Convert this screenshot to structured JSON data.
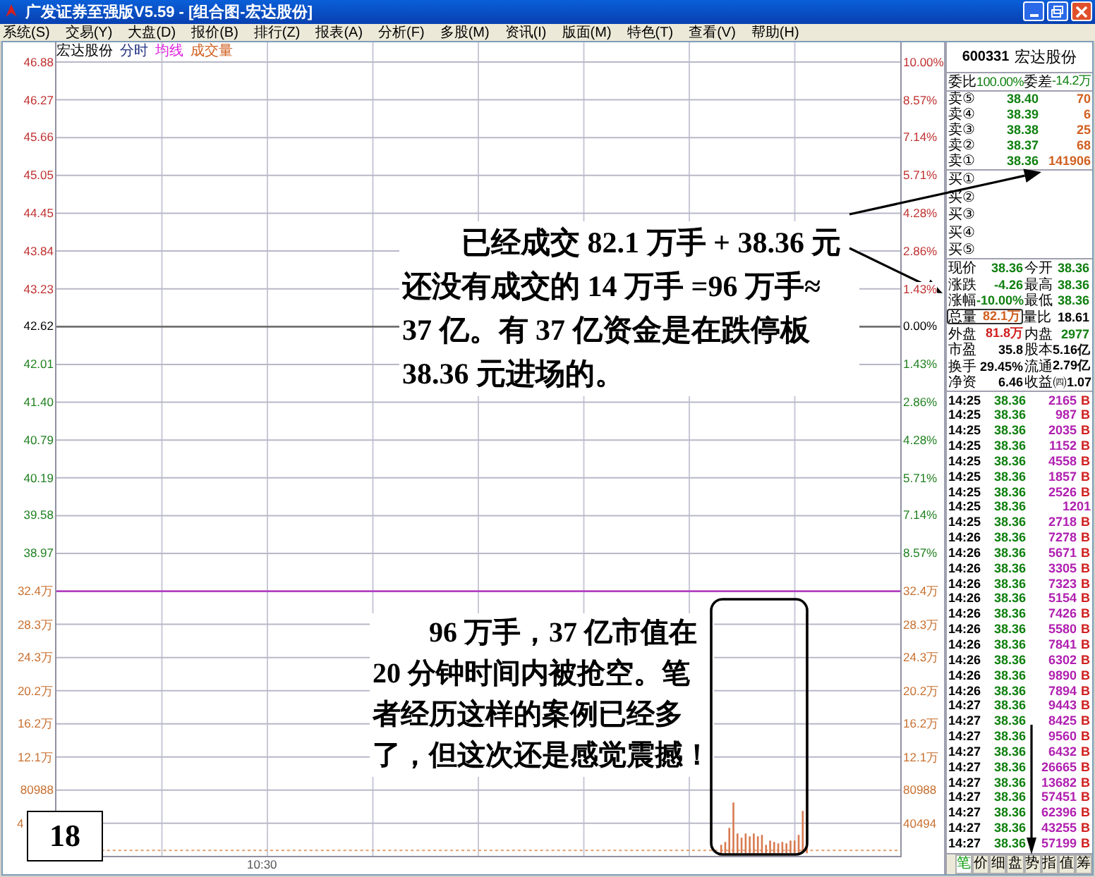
{
  "window": {
    "title": "广发证券至强版V5.59 - [组合图-宏达股份]"
  },
  "menu": [
    "系统(S)",
    "交易(Y)",
    "大盘(D)",
    "报价(B)",
    "排行(Z)",
    "报表(A)",
    "分析(F)",
    "多股(M)",
    "资讯(I)",
    "版面(M)",
    "特色(T)",
    "查看(V)",
    "帮助(H)"
  ],
  "chart": {
    "header": {
      "name": "宏达股份",
      "mode": "分时",
      "ma": "均线",
      "volume": "成交量"
    },
    "left_axis": [
      {
        "label": "46.88",
        "kind": "up"
      },
      {
        "label": "46.27",
        "kind": "up"
      },
      {
        "label": "45.66",
        "kind": "up"
      },
      {
        "label": "45.05",
        "kind": "up"
      },
      {
        "label": "44.45",
        "kind": "up"
      },
      {
        "label": "43.84",
        "kind": "up"
      },
      {
        "label": "43.23",
        "kind": "up"
      },
      {
        "label": "42.62",
        "kind": "flat"
      },
      {
        "label": "42.01",
        "kind": "down"
      },
      {
        "label": "41.40",
        "kind": "down"
      },
      {
        "label": "40.79",
        "kind": "down"
      },
      {
        "label": "40.19",
        "kind": "down"
      },
      {
        "label": "39.58",
        "kind": "down"
      },
      {
        "label": "38.97",
        "kind": "down"
      },
      {
        "label": "32.4万",
        "kind": "volume"
      },
      {
        "label": "28.3万",
        "kind": "volume"
      },
      {
        "label": "24.3万",
        "kind": "volume"
      },
      {
        "label": "20.2万",
        "kind": "volume"
      },
      {
        "label": "16.2万",
        "kind": "volume"
      },
      {
        "label": "12.1万",
        "kind": "volume"
      },
      {
        "label": "80988",
        "kind": "volume"
      },
      {
        "label": "4",
        "kind": "volume"
      }
    ],
    "right_axis": [
      {
        "label": "10.00%",
        "kind": "up"
      },
      {
        "label": "8.57%",
        "kind": "up"
      },
      {
        "label": "7.14%",
        "kind": "up"
      },
      {
        "label": "5.71%",
        "kind": "up"
      },
      {
        "label": "4.28%",
        "kind": "up"
      },
      {
        "label": "2.86%",
        "kind": "up"
      },
      {
        "label": "1.43%",
        "kind": "up"
      },
      {
        "label": "0.00%",
        "kind": "flat"
      },
      {
        "label": "1.43%",
        "kind": "down"
      },
      {
        "label": "2.86%",
        "kind": "down"
      },
      {
        "label": "4.28%",
        "kind": "down"
      },
      {
        "label": "5.71%",
        "kind": "down"
      },
      {
        "label": "7.14%",
        "kind": "down"
      },
      {
        "label": "8.57%",
        "kind": "down"
      },
      {
        "label": "32.4万",
        "kind": "volume"
      },
      {
        "label": "28.3万",
        "kind": "volume"
      },
      {
        "label": "24.3万",
        "kind": "volume"
      },
      {
        "label": "20.2万",
        "kind": "volume"
      },
      {
        "label": "16.2万",
        "kind": "volume"
      },
      {
        "label": "12.1万",
        "kind": "volume"
      },
      {
        "label": "80988",
        "kind": "volume"
      },
      {
        "label": "40494",
        "kind": "volume"
      }
    ],
    "time_label": "10:30"
  },
  "quote": {
    "code": "600331",
    "name": "宏达股份",
    "ratio": [
      {
        "label": "委比",
        "value": "100.00%",
        "color": "#108010"
      },
      {
        "label": "委差",
        "value": "-14.2万",
        "color": "#108010"
      }
    ],
    "asks": [
      {
        "label": "卖⑤",
        "price": "38.40",
        "volume": "70"
      },
      {
        "label": "卖④",
        "price": "38.39",
        "volume": "6"
      },
      {
        "label": "卖③",
        "price": "38.38",
        "volume": "25"
      },
      {
        "label": "卖②",
        "price": "38.37",
        "volume": "68"
      },
      {
        "label": "卖①",
        "price": "38.36",
        "volume": "141906"
      }
    ],
    "bids": [
      "买①",
      "买②",
      "买③",
      "买④",
      "买⑤"
    ],
    "stats": [
      [
        {
          "label": "现价",
          "value": "38.36",
          "color": "#108010",
          "highlighted": false
        },
        {
          "label": "今开",
          "value": "38.36",
          "color": "#108010",
          "highlighted": false
        }
      ],
      [
        {
          "label": "涨跌",
          "value": "-4.26",
          "color": "#108010",
          "highlighted": false
        },
        {
          "label": "最高",
          "value": "38.36",
          "color": "#108010",
          "highlighted": false
        }
      ],
      [
        {
          "label": "涨幅",
          "value": "-10.00%",
          "color": "#108010",
          "highlighted": false
        },
        {
          "label": "最低",
          "value": "38.36",
          "color": "#108010",
          "highlighted": false
        }
      ],
      [
        {
          "label": "总量",
          "value": "82.1万",
          "color": "#d06020",
          "highlighted": true
        },
        {
          "label": "量比",
          "value": "18.61",
          "color": "#000000",
          "highlighted": false
        }
      ],
      [
        {
          "label": "外盘",
          "value": "81.8万",
          "color": "#d02020",
          "highlighted": false
        },
        {
          "label": "内盘",
          "value": "2977",
          "color": "#108010",
          "highlighted": false
        }
      ],
      [
        {
          "label": "市盈",
          "value": "35.8",
          "color": "#000000",
          "highlighted": false
        },
        {
          "label": "股本",
          "value": "5.16亿",
          "color": "#000000",
          "highlighted": false
        }
      ],
      [
        {
          "label": "换手",
          "value": "29.45%",
          "color": "#000000",
          "highlighted": false
        },
        {
          "label": "流通",
          "value": "2.79亿",
          "color": "#000000",
          "highlighted": false
        }
      ],
      [
        {
          "label": "净资",
          "value": "6.46",
          "color": "#000000",
          "highlighted": false
        },
        {
          "label": "收益㈣",
          "value": "1.07",
          "color": "#000000",
          "highlighted": false
        }
      ]
    ],
    "ticks": [
      {
        "time": "14:25",
        "price": "38.36",
        "volume": "2165",
        "side": "B"
      },
      {
        "time": "14:25",
        "price": "38.36",
        "volume": "987",
        "side": "B"
      },
      {
        "time": "14:25",
        "price": "38.36",
        "volume": "2035",
        "side": "B"
      },
      {
        "time": "14:25",
        "price": "38.36",
        "volume": "1152",
        "side": "B"
      },
      {
        "time": "14:25",
        "price": "38.36",
        "volume": "4558",
        "side": "B"
      },
      {
        "time": "14:25",
        "price": "38.36",
        "volume": "1857",
        "side": "B"
      },
      {
        "time": "14:25",
        "price": "38.36",
        "volume": "2526",
        "side": "B"
      },
      {
        "time": "14:25",
        "price": "38.36",
        "volume": "1201"
      },
      {
        "time": "14:25",
        "price": "38.36",
        "volume": "2718",
        "side": "B"
      },
      {
        "time": "14:26",
        "price": "38.36",
        "volume": "7278",
        "side": "B"
      },
      {
        "time": "14:26",
        "price": "38.36",
        "volume": "5671",
        "side": "B"
      },
      {
        "time": "14:26",
        "price": "38.36",
        "volume": "3305",
        "side": "B"
      },
      {
        "time": "14:26",
        "price": "38.36",
        "volume": "7323",
        "side": "B"
      },
      {
        "time": "14:26",
        "price": "38.36",
        "volume": "5154",
        "side": "B"
      },
      {
        "time": "14:26",
        "price": "38.36",
        "volume": "7426",
        "side": "B"
      },
      {
        "time": "14:26",
        "price": "38.36",
        "volume": "5580",
        "side": "B"
      },
      {
        "time": "14:26",
        "price": "38.36",
        "volume": "7841",
        "side": "B"
      },
      {
        "time": "14:26",
        "price": "38.36",
        "volume": "6302",
        "side": "B"
      },
      {
        "time": "14:26",
        "price": "38.36",
        "volume": "9890",
        "side": "B"
      },
      {
        "time": "14:26",
        "price": "38.36",
        "volume": "7894",
        "side": "B"
      },
      {
        "time": "14:27",
        "price": "38.36",
        "volume": "9443",
        "side": "B"
      },
      {
        "time": "14:27",
        "price": "38.36",
        "volume": "8425",
        "side": "B"
      },
      {
        "time": "14:27",
        "price": "38.36",
        "volume": "9560",
        "side": "B"
      },
      {
        "time": "14:27",
        "price": "38.36",
        "volume": "6432",
        "side": "B"
      },
      {
        "time": "14:27",
        "price": "38.36",
        "volume": "26665",
        "side": "B"
      },
      {
        "time": "14:27",
        "price": "38.36",
        "volume": "13682",
        "side": "B"
      },
      {
        "time": "14:27",
        "price": "38.36",
        "volume": "57451",
        "side": "B"
      },
      {
        "time": "14:27",
        "price": "38.36",
        "volume": "62396",
        "side": "B"
      },
      {
        "time": "14:27",
        "price": "38.36",
        "volume": "43255",
        "side": "B"
      },
      {
        "time": "14:27",
        "price": "38.36",
        "volume": "57199",
        "side": "B"
      }
    ],
    "tabs": [
      {
        "label": "笔",
        "selected": true
      },
      {
        "label": "价",
        "selected": false
      },
      {
        "label": "细",
        "selected": false
      },
      {
        "label": "盘",
        "selected": false
      },
      {
        "label": "势",
        "selected": false
      },
      {
        "label": "指",
        "selected": false
      },
      {
        "label": "值",
        "selected": false
      },
      {
        "label": "筹",
        "selected": false
      }
    ]
  },
  "notes": [
    "已经成交 82.1 万手 + 38.36 元还没有成交的 14 万手 =96 万手≈ 37 亿。有 37 亿资金是在跌停板 38.36 元进场的。",
    "96 万手，37 亿市值在 20 分钟时间内被抢空。笔者经历这样的案例已经多了，但这次还是感觉震撼！"
  ],
  "figure_number": "18"
}
